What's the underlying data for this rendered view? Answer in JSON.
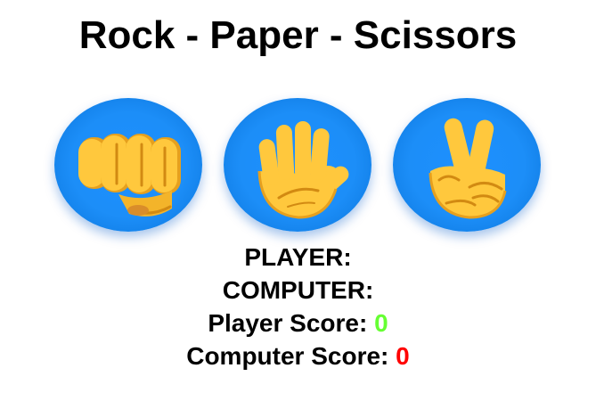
{
  "title": "Rock - Paper - Scissors",
  "choices": [
    {
      "id": "rock",
      "icon": "fist-icon"
    },
    {
      "id": "paper",
      "icon": "raised-hand-icon"
    },
    {
      "id": "scissors",
      "icon": "victory-hand-icon"
    }
  ],
  "status": {
    "player_label": "PLAYER:",
    "player_choice": "",
    "computer_label": "COMPUTER:",
    "computer_choice": "",
    "player_score_label": "Player Score:",
    "player_score": "0",
    "computer_score_label": "Computer Score:",
    "computer_score": "0"
  },
  "colors": {
    "button_blue": "#1e90ff",
    "hand_yellow": "#ffc83d",
    "player_score": "#66ff33",
    "computer_score": "#ff0000"
  }
}
